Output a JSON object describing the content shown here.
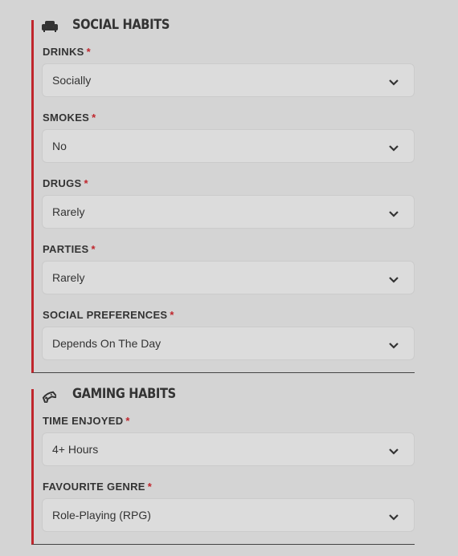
{
  "social_habits": {
    "title": "SOCIAL HABITS",
    "icon": "sofa-icon",
    "fields": [
      {
        "label": "DRINKS",
        "required": "*",
        "value": "Socially"
      },
      {
        "label": "SMOKES",
        "required": "*",
        "value": "No"
      },
      {
        "label": "DRUGS",
        "required": "*",
        "value": "Rarely"
      },
      {
        "label": "PARTIES",
        "required": "*",
        "value": "Rarely"
      },
      {
        "label": "SOCIAL PREFERENCES",
        "required": "*",
        "value": "Depends On The Day"
      }
    ]
  },
  "gaming_habits": {
    "title": "GAMING HABITS",
    "icon": "gamepad-icon",
    "fields": [
      {
        "label": "TIME ENJOYED",
        "required": "*",
        "value": "4+ Hours"
      },
      {
        "label": "FAVOURITE GENRE",
        "required": "*",
        "value": "Role-Playing (RPG)"
      }
    ]
  },
  "colors": {
    "accent": "#c0262d",
    "background": "#d4d4d4",
    "select_background": "#dcdcdc",
    "text": "#333333"
  }
}
